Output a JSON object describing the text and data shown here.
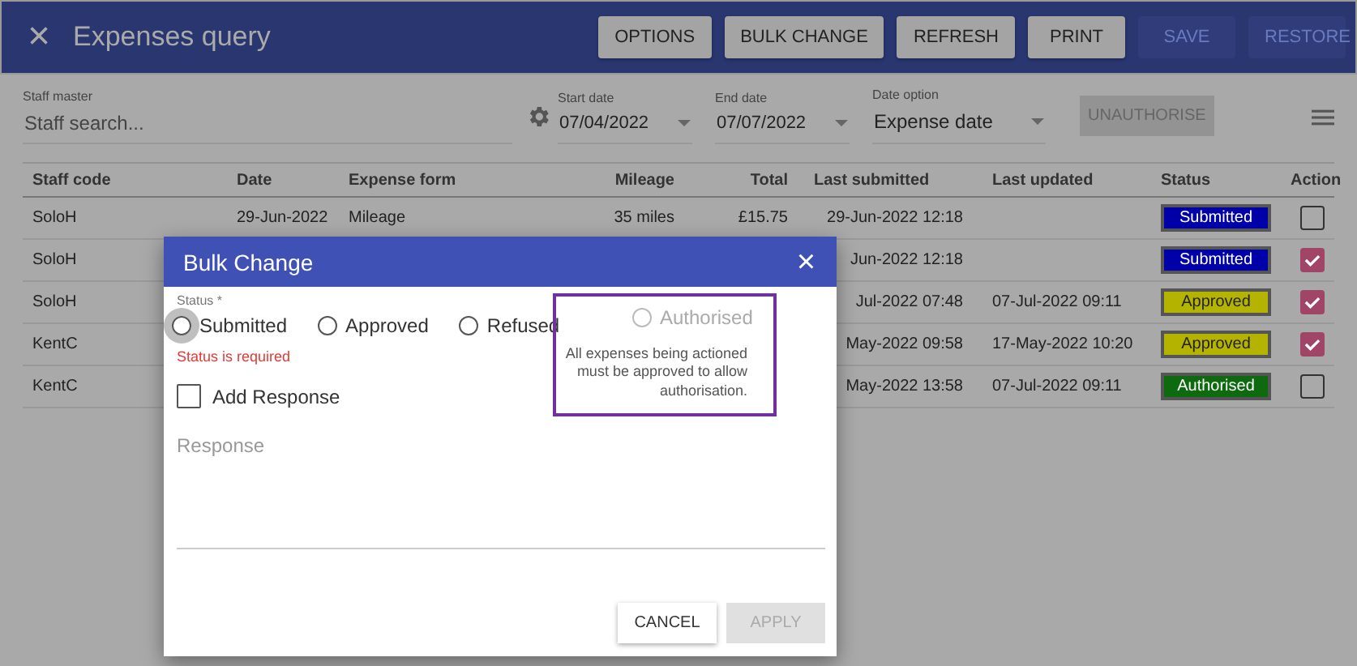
{
  "app_bar": {
    "close_icon": "×",
    "title": "Expenses query",
    "buttons": [
      {
        "label": "OPTIONS",
        "disabled": false
      },
      {
        "label": "BULK CHANGE",
        "disabled": false
      },
      {
        "label": "REFRESH",
        "disabled": false
      },
      {
        "label": "PRINT",
        "disabled": false
      },
      {
        "label": "SAVE",
        "disabled": true
      },
      {
        "label": "RESTORE",
        "disabled": true
      }
    ]
  },
  "filters": {
    "staff_master": {
      "label": "Staff master",
      "placeholder": "Staff search..."
    },
    "start_date": {
      "label": "Start date",
      "value": "07/04/2022"
    },
    "end_date": {
      "label": "End date",
      "value": "07/07/2022"
    },
    "date_option": {
      "label": "Date option",
      "value": "Expense date"
    },
    "unauthorise_button": {
      "label": "UNAUTHORISE",
      "disabled": true
    }
  },
  "table": {
    "columns": [
      "Staff code",
      "Date",
      "Expense form",
      "Mileage",
      "Total",
      "Last submitted",
      "Last updated",
      "Status",
      "Action"
    ],
    "rows": [
      {
        "staff_code": "SoloH",
        "date": "29-Jun-2022",
        "expense_form": "Mileage",
        "mileage": "35 miles",
        "total": "£15.75",
        "last_submitted": "29-Jun-2022 12:18",
        "status": "Submitted",
        "color": "#0000a8",
        "checked": false
      },
      {
        "staff_code": "SoloH",
        "last_submitted": "Jun-2022 12:18",
        "status": "Submitted",
        "color": "#0000a8",
        "checked": true
      },
      {
        "staff_code": "SoloH",
        "last_submitted": "Jul-2022 07:48",
        "last_updated": "07-Jul-2022 09:11",
        "status": "Approved",
        "color": "#b4b400",
        "checked": true
      },
      {
        "staff_code": "KentC",
        "last_submitted": "May-2022 09:58",
        "last_updated": "17-May-2022 10:20",
        "status": "Approved",
        "color": "#b4b400",
        "checked": true
      },
      {
        "staff_code": "KentC",
        "last_submitted": "May-2022 13:58",
        "last_updated": "07-Jul-2022 09:11",
        "status": "Authorised",
        "color": "#0e6a0e",
        "checked": false
      }
    ]
  },
  "dialog": {
    "title": "Bulk Change",
    "close_icon": "×",
    "status_label": "Status *",
    "options": [
      {
        "label": "Submitted",
        "selected": false,
        "disabled": false,
        "focused": true
      },
      {
        "label": "Approved",
        "selected": false,
        "disabled": false,
        "focused": false
      },
      {
        "label": "Refused",
        "selected": false,
        "disabled": false,
        "focused": false
      },
      {
        "label": "Authorised",
        "selected": false,
        "disabled": true,
        "focused": false
      }
    ],
    "error": "Status is required",
    "hint": "All expenses being actioned must be approved to allow authorisation.",
    "add_response": {
      "label": "Add Response",
      "checked": false
    },
    "response": {
      "placeholder": "Response"
    },
    "buttons": [
      {
        "label": "CANCEL",
        "disabled": false
      },
      {
        "label": "APPLY",
        "disabled": true
      }
    ]
  }
}
